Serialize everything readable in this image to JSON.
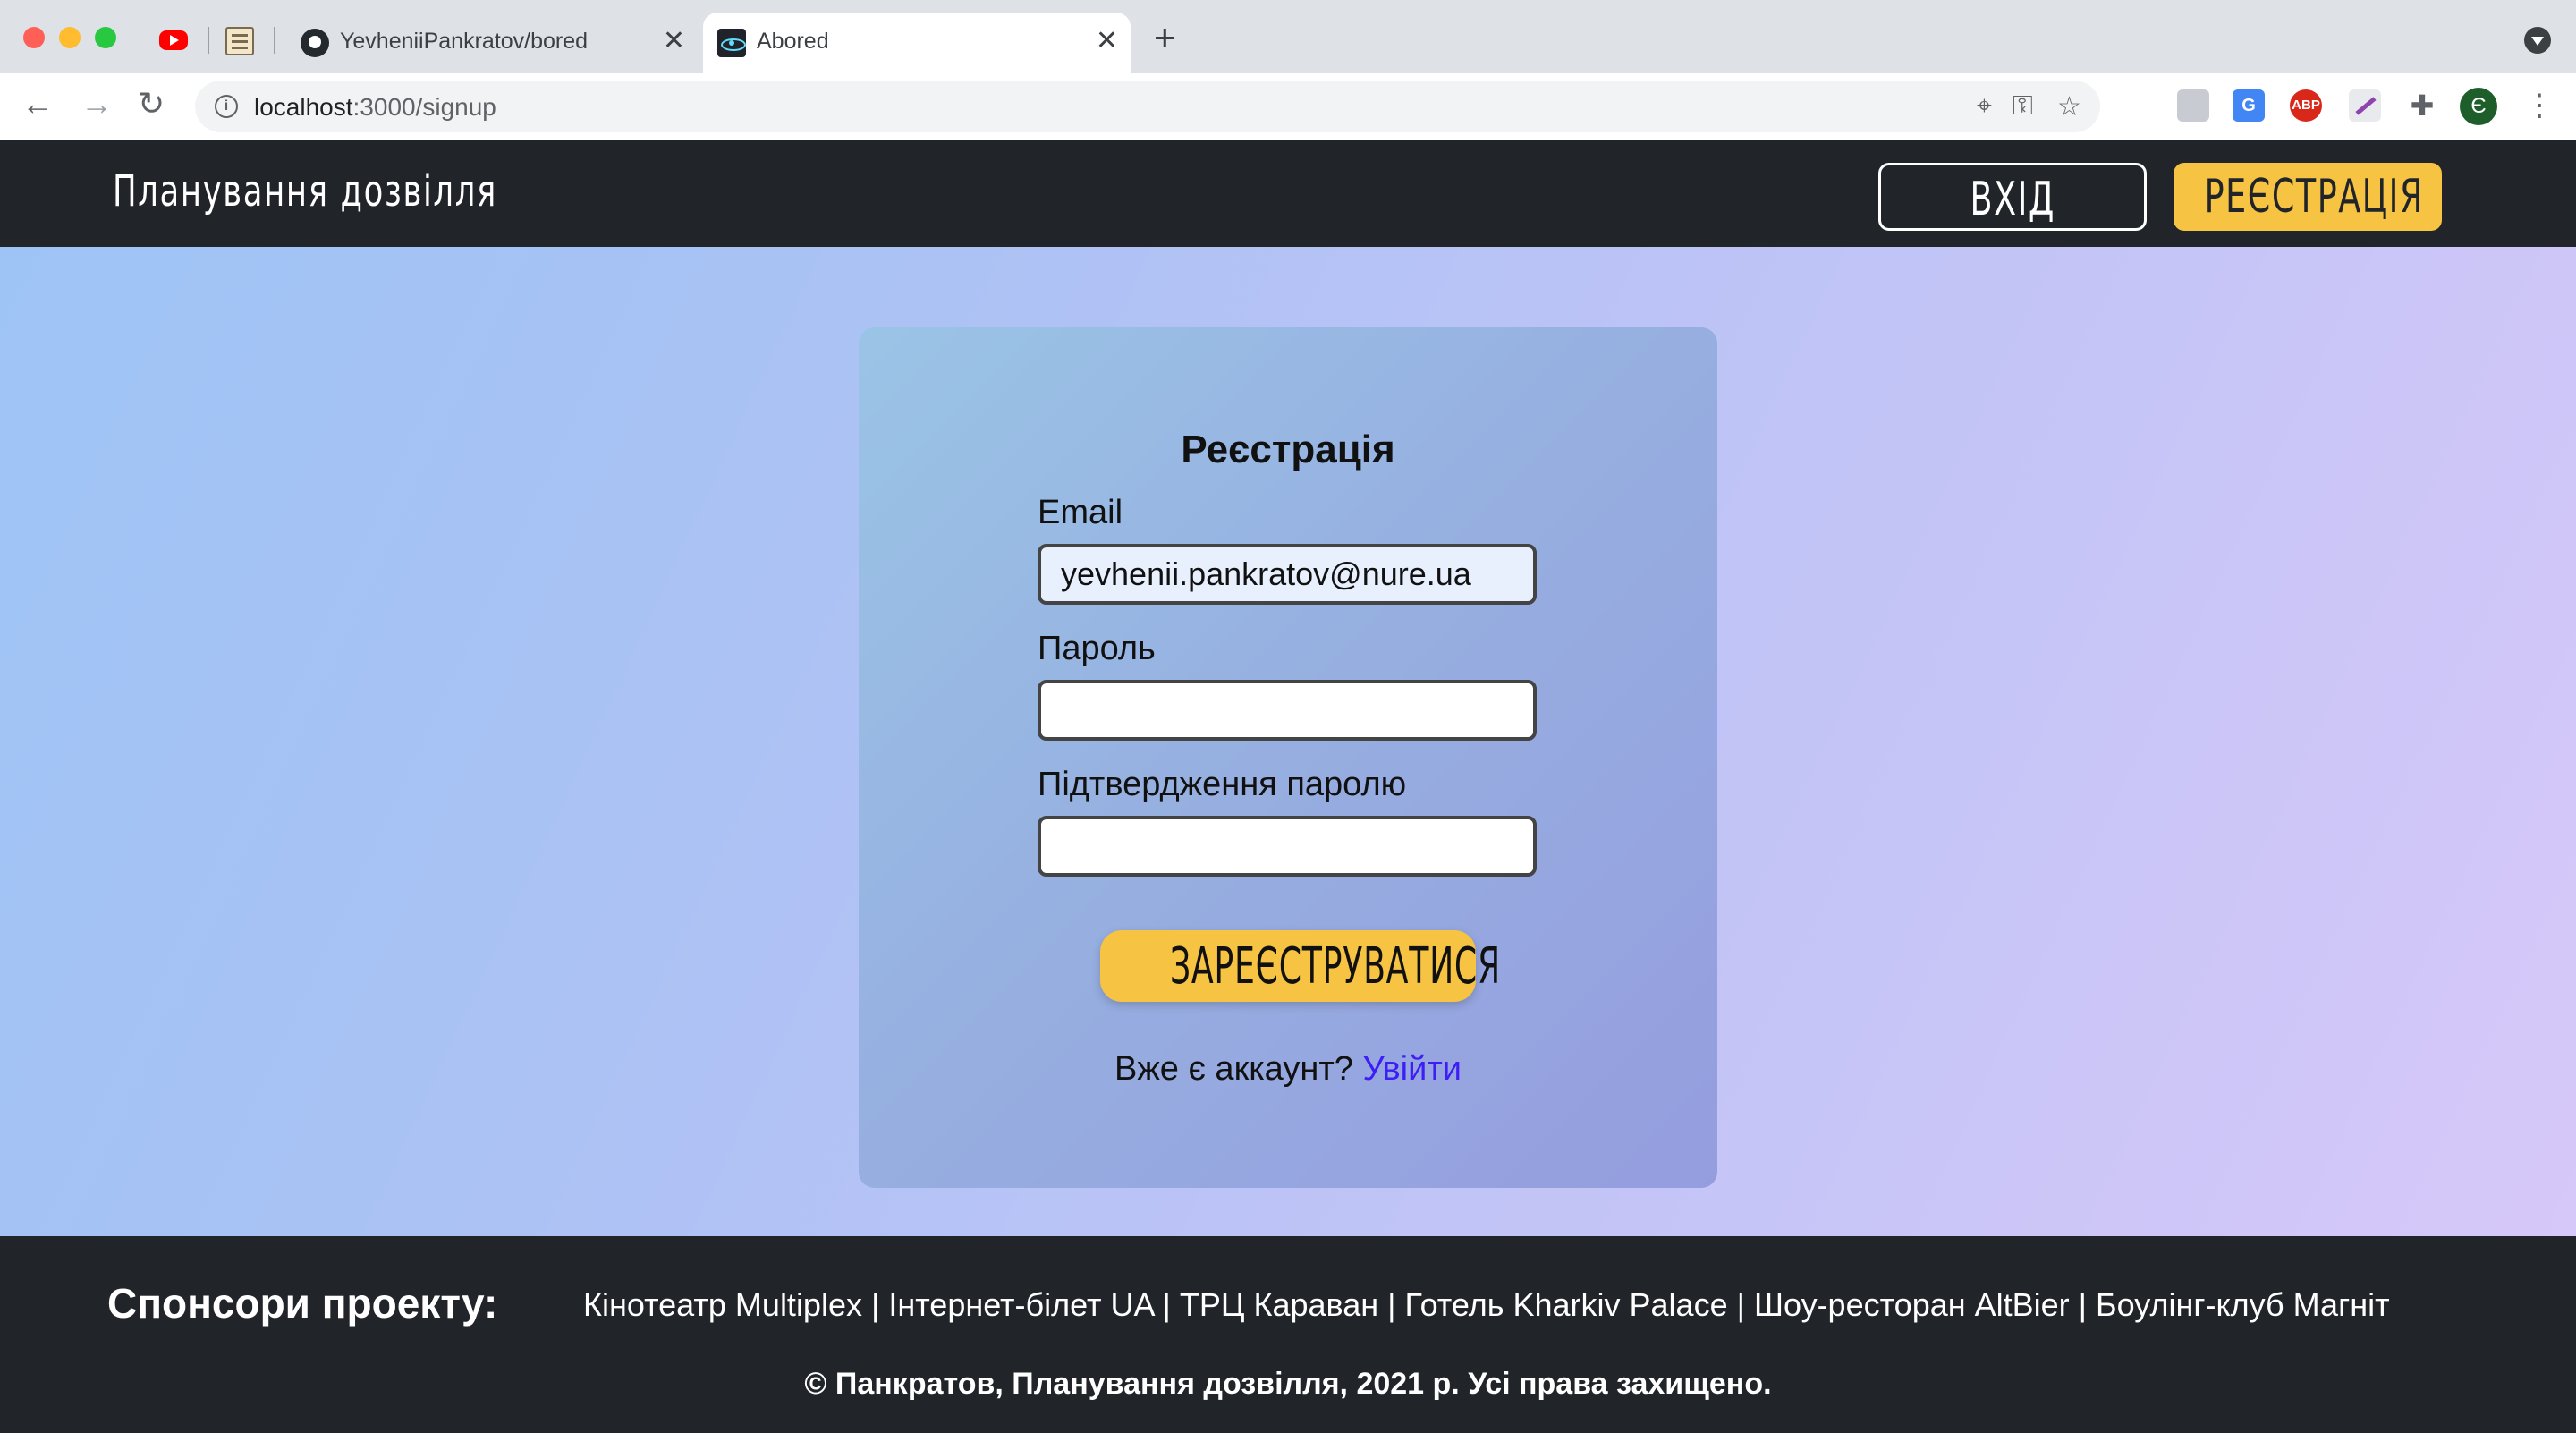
{
  "browser": {
    "tabs": [
      {
        "title": "YevheniiPankratov/bored"
      },
      {
        "title": "Abored",
        "active": true
      }
    ],
    "url_host": "localhost",
    "url_path": ":3000/signup",
    "profile_initial": "Є",
    "translate_ext_label": "G",
    "adblock_label": "ABP"
  },
  "site_header": {
    "brand": "Планування дозвілля",
    "login_label": "ВХІД",
    "signup_label": "РЕЄСТРАЦІЯ"
  },
  "signup_form": {
    "title": "Реєстрація",
    "email_label": "Email",
    "email_value": "yevhenii.pankratov@nure.ua",
    "password_label": "Пароль",
    "password_value": "",
    "confirm_label": "Підтвердження паролю",
    "confirm_value": "",
    "submit_label": "ЗАРЕЄСТРУВАТИСЯ",
    "have_account_text": "Вже є аккаунт?",
    "login_link": "Увійти"
  },
  "footer": {
    "sponsors_title": "Спонсори проекту:",
    "sponsors_list": "Кінотеатр Multiplex | Інтернет-білет UA | ТРЦ Караван | Готель Kharkiv Palace | Шоу-ресторан AltBier | Боулінг-клуб Магніт",
    "copyright": "© Панкратов, Планування дозвілля, 2021 р. Усі права захищено."
  },
  "colors": {
    "header_bg": "#212529",
    "accent_yellow": "#f6c343",
    "link_blue": "#3d1ff5"
  },
  "icons": {
    "pinned_tabs": [
      "youtube-icon",
      "notes-icon"
    ],
    "tab_icons": [
      "github-icon",
      "react-icon"
    ],
    "toolbar": [
      "back-icon",
      "forward-icon",
      "reload-icon",
      "info-icon",
      "location-icon",
      "key-icon",
      "star-icon",
      "puzzle-icon",
      "kebab-menu-icon"
    ]
  }
}
